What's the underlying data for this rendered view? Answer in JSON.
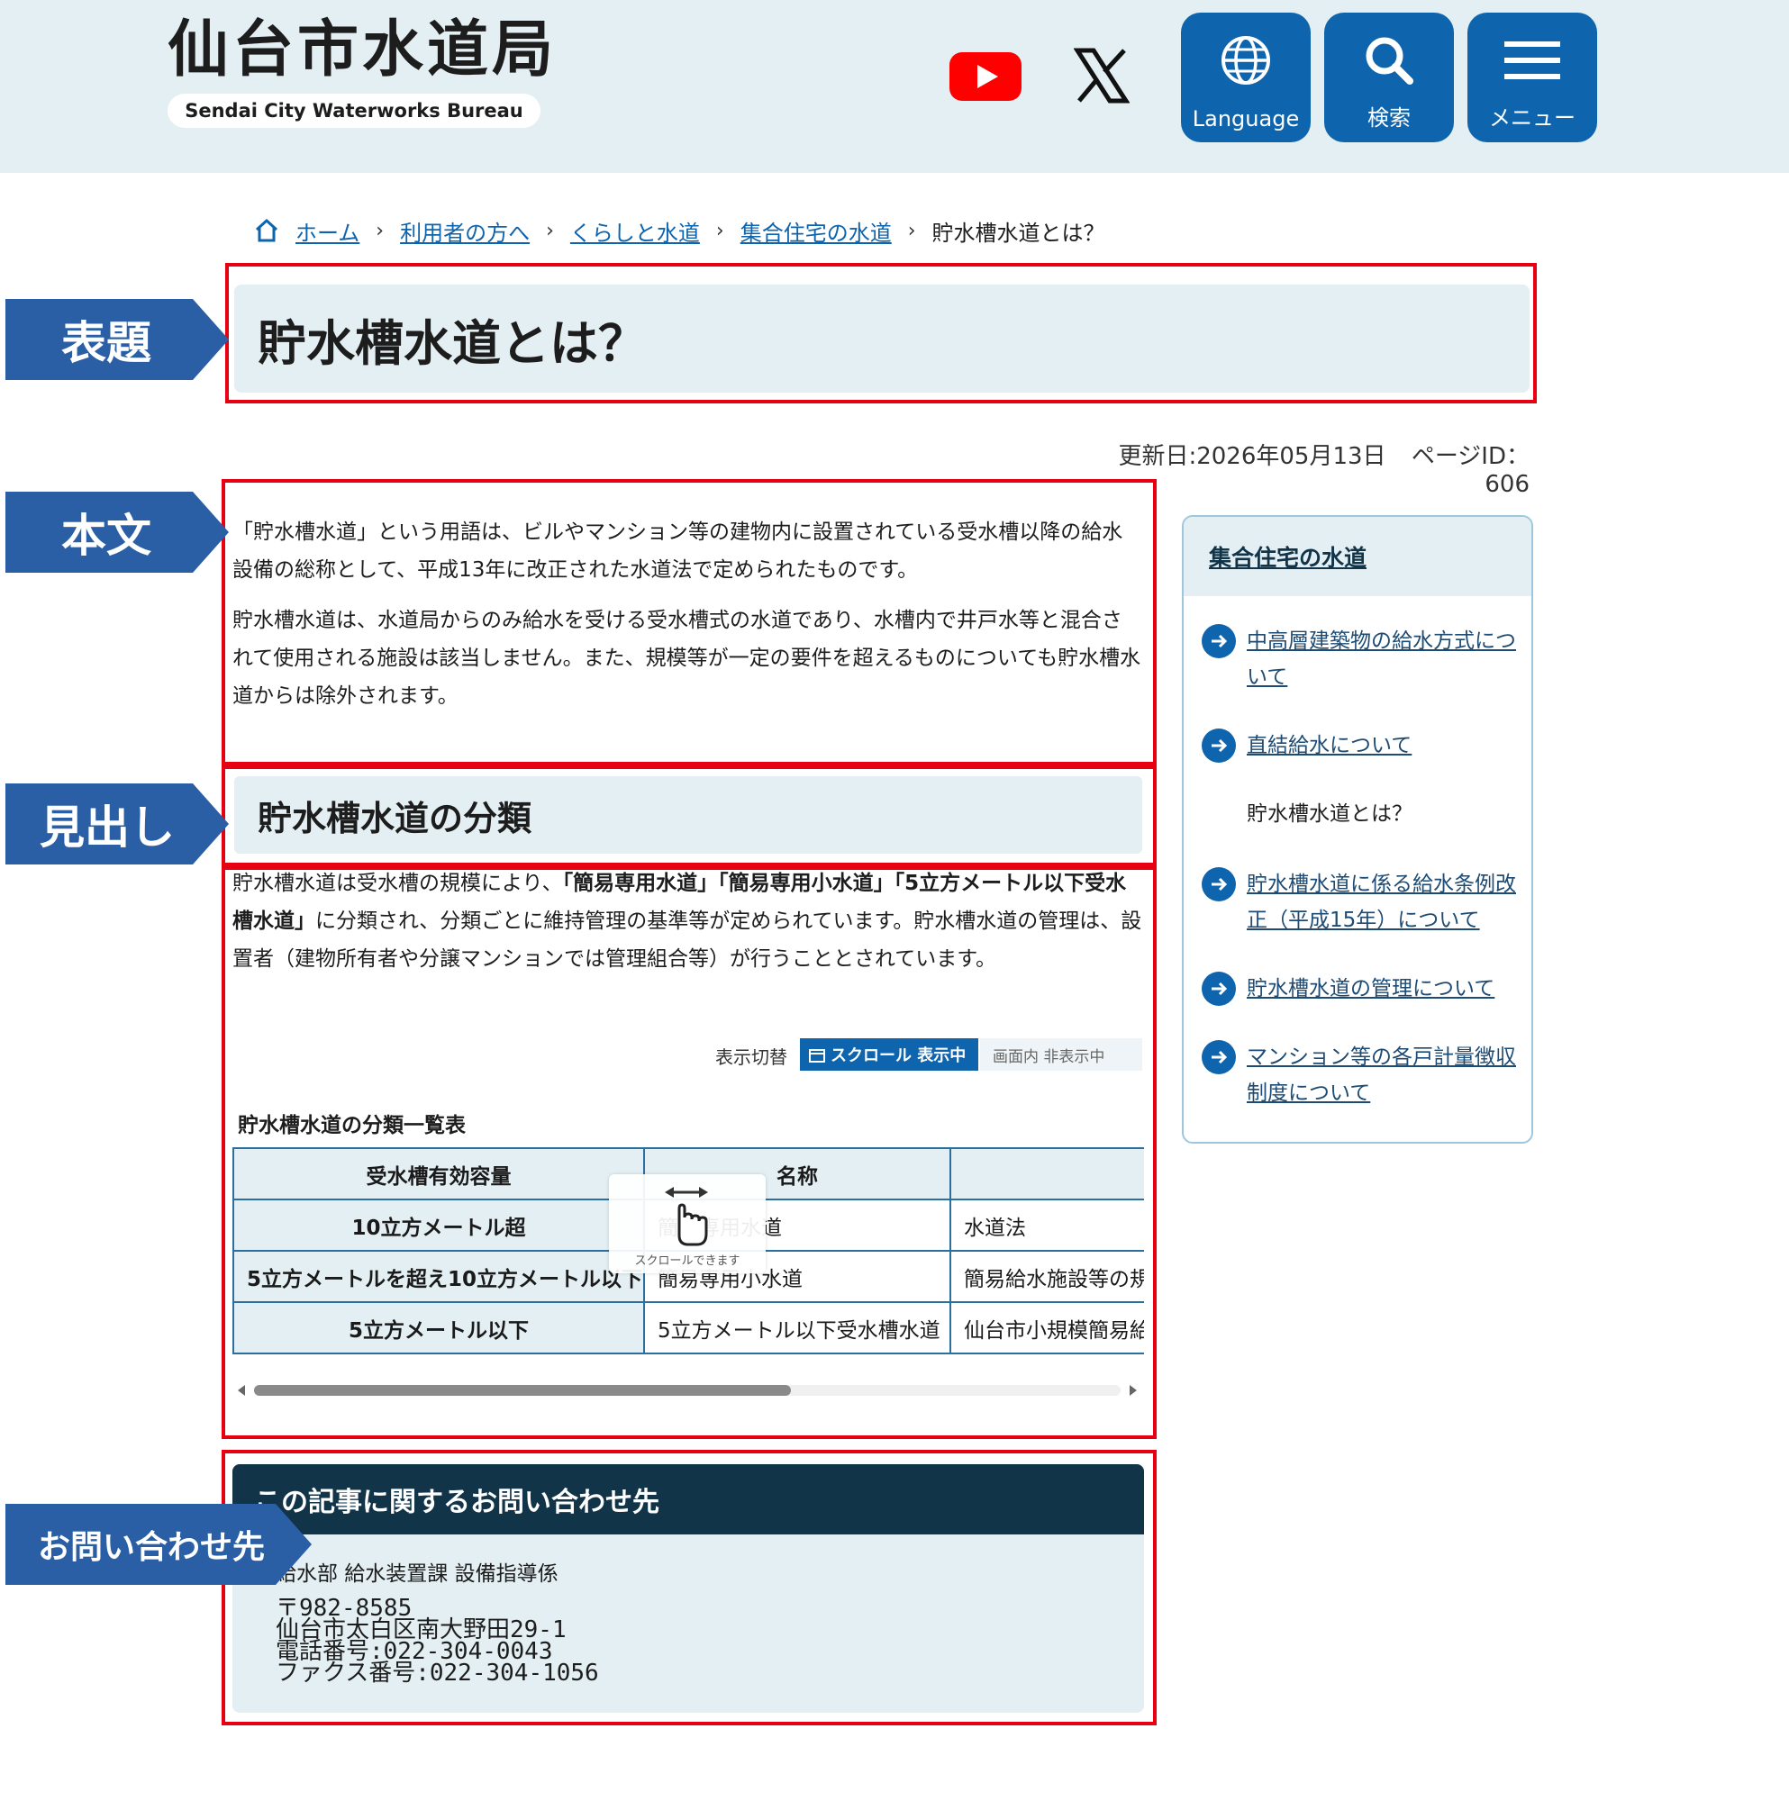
{
  "header": {
    "title": "仙台市水道局",
    "subtitle": "Sendai City Waterworks Bureau",
    "buttons": {
      "language": "Language",
      "search": "検索",
      "menu": "メニュー"
    }
  },
  "breadcrumb": {
    "items": [
      "ホーム",
      "利用者の方へ",
      "くらしと水道",
      "集合住宅の水道"
    ],
    "current": "貯水槽水道とは？"
  },
  "annotations": {
    "title_tag": "表題",
    "body_tag": "本文",
    "heading_tag": "見出し",
    "contact_tag": "お問い合わせ先"
  },
  "page": {
    "title": "貯水槽水道とは？",
    "updated": "更新日:2026年05月13日",
    "page_id": "ページID：606",
    "paragraphs": [
      "「貯水槽水道」という用語は、ビルやマンション等の建物内に設置されている受水槽以降の給水設備の総称として、平成13年に改正された水道法で定められたものです。",
      "貯水槽水道は、水道局からのみ給水を受ける受水槽式の水道であり、水槽内で井戸水等と混合されて使用される施設は該当しません。また、規模等が一定の要件を超えるものについても貯水槽水道からは除外されます。"
    ]
  },
  "section": {
    "heading": "貯水槽水道の分類",
    "text_a": "貯水槽水道は受水槽の規模により、",
    "text_b": "「簡易専用水道」「簡易専用小水道」「5立方メートル以下受水槽水道」",
    "text_c": "に分類され、分類ごとに維持管理の基準等が定められています。貯水槽水道の管理は、設置者（建物所有者や分譲マンションでは管理組合等）が行うこととされています。",
    "toggle_label": "表示切替",
    "toggle_on": "スクロール 表示中",
    "toggle_off": "画面内 非表示中",
    "table_caption": "貯水槽水道の分類一覧表",
    "table": {
      "headers": [
        "受水槽有効容量",
        "名称",
        ""
      ],
      "rows": [
        [
          "10立方メートル超",
          "簡易専用水道",
          "水道法"
        ],
        [
          "5立方メートルを超え10立方メートル以下",
          "簡易専用小水道",
          "簡易給水施設等の規"
        ],
        [
          "5立方メートル以下",
          "5立方メートル以下受水槽水道",
          "仙台市小規模簡易給"
        ]
      ]
    },
    "scroll_hint": "スクロールできます",
    "scroll_position": 0.62
  },
  "contact": {
    "heading": "この記事に関するお問い合わせ先",
    "dept": "給水部 給水装置課 設備指導係",
    "postal": "〒982-8585",
    "address": "仙台市太白区南大野田29-1",
    "tel": "電話番号:022-304-0043",
    "fax": "ファクス番号:022-304-1056"
  },
  "sidebar": {
    "heading": "集合住宅の水道",
    "items": [
      {
        "label": "中高層建築物の給水方式について",
        "link": true
      },
      {
        "label": "直結給水について",
        "link": true
      },
      {
        "label": "貯水槽水道とは？",
        "link": false
      },
      {
        "label": "貯水槽水道に係る給水条例改正（平成15年）について",
        "link": true
      },
      {
        "label": "貯水槽水道の管理について",
        "link": true
      },
      {
        "label": "マンション等の各戸計量徴収制度について",
        "link": true
      }
    ]
  },
  "colors": {
    "accent": "#0e64ad",
    "annotation": "#2a5fa5",
    "highlight_box": "#e60012",
    "panel": "#e3eff3",
    "contact_head": "#123449"
  }
}
